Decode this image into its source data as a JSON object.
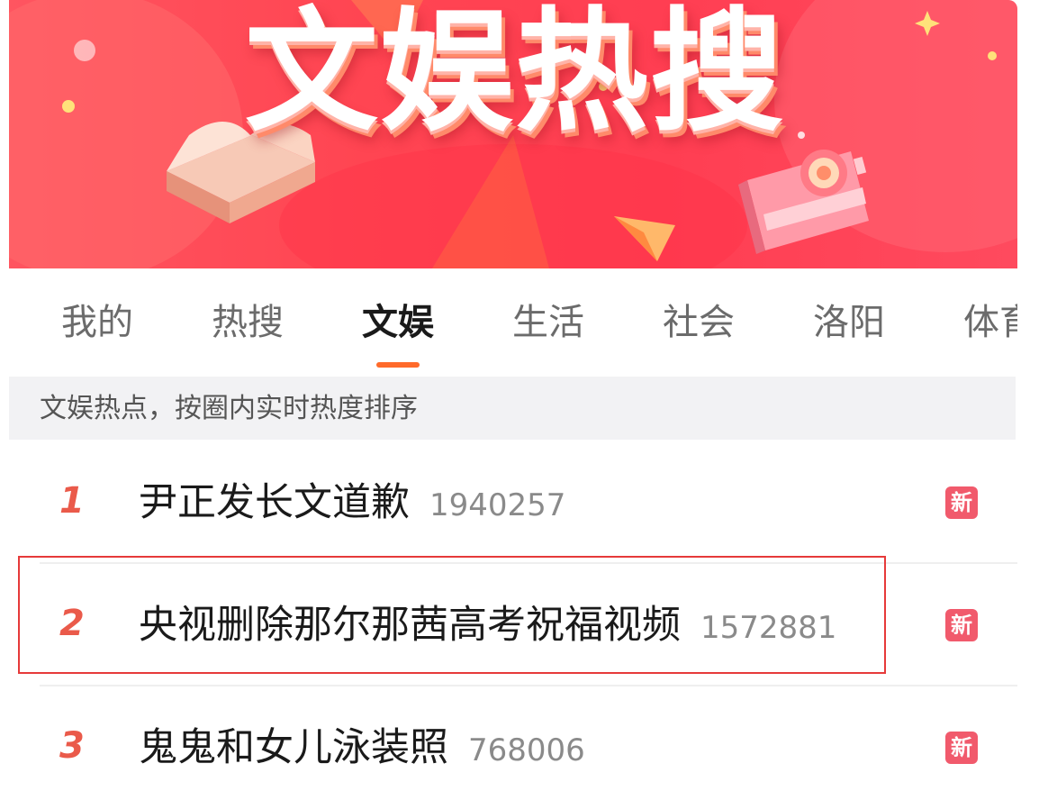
{
  "banner": {
    "title": "文娱热搜"
  },
  "tabs": [
    {
      "label": "我的",
      "active": false
    },
    {
      "label": "热搜",
      "active": false
    },
    {
      "label": "文娱",
      "active": true
    },
    {
      "label": "生活",
      "active": false
    },
    {
      "label": "社会",
      "active": false
    },
    {
      "label": "洛阳",
      "active": false
    },
    {
      "label": "体育",
      "active": false
    }
  ],
  "info": {
    "text": "文娱热点，按圈内实时热度排序"
  },
  "list": [
    {
      "rank": "1",
      "title": "尹正发长文道歉",
      "count": "1940257",
      "badge": "新"
    },
    {
      "rank": "2",
      "title": "央视删除那尔那茜高考祝福视频",
      "count": "1572881",
      "badge": "新",
      "highlighted": true
    },
    {
      "rank": "3",
      "title": "鬼鬼和女儿泳装照",
      "count": "768006",
      "badge": "新"
    }
  ],
  "colors": {
    "banner_red": "#ff4552",
    "tab_indicator": "#ff6a2a",
    "rank_color": "#ea5a4a",
    "badge_bg": "#f15a6c",
    "highlight_border": "#e63a3a"
  },
  "icons": [
    "book-illustration-icon",
    "camera-illustration-icon",
    "paper-plane-illustration-icon",
    "sparkle-icon"
  ]
}
